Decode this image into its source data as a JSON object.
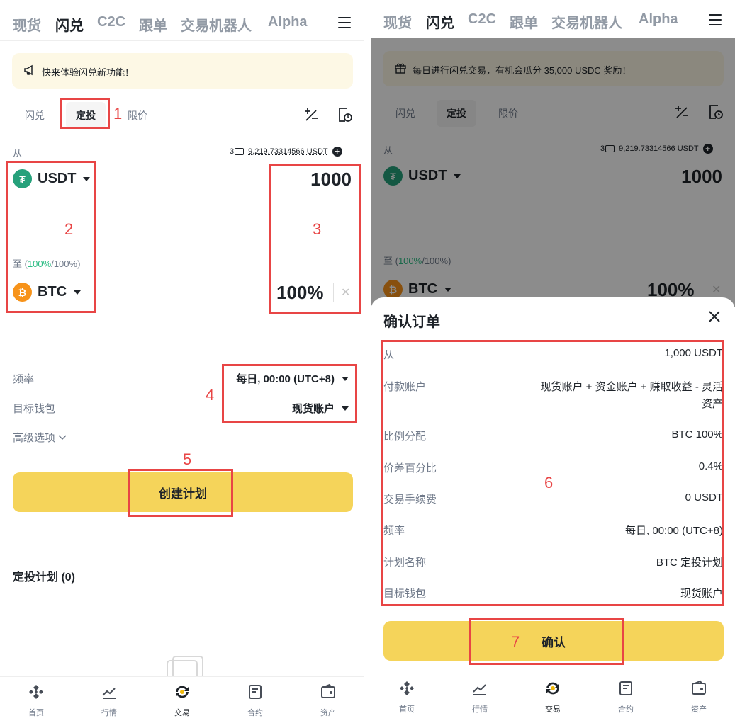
{
  "nav": {
    "tabs": [
      "现货",
      "闪兑",
      "C2C",
      "跟单",
      "交易机器人",
      "Alpha"
    ],
    "active_tab": "闪兑"
  },
  "left": {
    "banner_text": "快来体验闪兑新功能！",
    "subtabs": [
      "闪兑",
      "定投",
      "限价"
    ],
    "active_subtab": "定投",
    "from_label": "从",
    "wallet_count": "3",
    "balance": "9,219.73314566 USDT",
    "from_coin": "USDT",
    "from_amount": "1000",
    "to_label_prefix": "至 (",
    "to_label_pct": "100%",
    "to_label_suffix": "/100%)",
    "to_coin": "BTC",
    "to_pct": "100%",
    "frequency_label": "频率",
    "frequency_value": "每日, 00:00 (UTC+8)",
    "wallet_label": "目标钱包",
    "wallet_value": "现货账户",
    "advanced_label": "高级选项",
    "create_button": "创建计划",
    "plans_title": "定投计划 (0)"
  },
  "right": {
    "banner_text": "每日进行闪兑交易，有机会瓜分 35,000 USDC 奖励！",
    "sheet_title": "确认订单",
    "details": [
      {
        "label": "从",
        "value": "1,000 USDT"
      },
      {
        "label": "付款账户",
        "value": "现货账户 + 资金账户 + 赚取收益 - 灵活资产"
      },
      {
        "label": "比例分配",
        "value": "BTC 100%"
      },
      {
        "label": "价差百分比",
        "value": "0.4%"
      },
      {
        "label": "交易手续费",
        "value": "0 USDT"
      },
      {
        "label": "频率",
        "value": "每日, 00:00 (UTC+8)"
      },
      {
        "label": "计划名称",
        "value": "BTC 定投计划"
      },
      {
        "label": "目标钱包",
        "value": "现货账户"
      }
    ],
    "confirm_button": "确认"
  },
  "bottom_nav": [
    {
      "label": "首页",
      "icon": "home-icon"
    },
    {
      "label": "行情",
      "icon": "markets-icon"
    },
    {
      "label": "交易",
      "icon": "trade-icon"
    },
    {
      "label": "合约",
      "icon": "futures-icon"
    },
    {
      "label": "资产",
      "icon": "assets-icon"
    }
  ],
  "annotations": [
    "1",
    "2",
    "3",
    "4",
    "5",
    "6",
    "7"
  ],
  "colors": {
    "accent_yellow": "#f5d45a",
    "annotation_red": "#e84545",
    "up_green": "#2ebd85",
    "banner_bg": "#fdf8e5"
  }
}
